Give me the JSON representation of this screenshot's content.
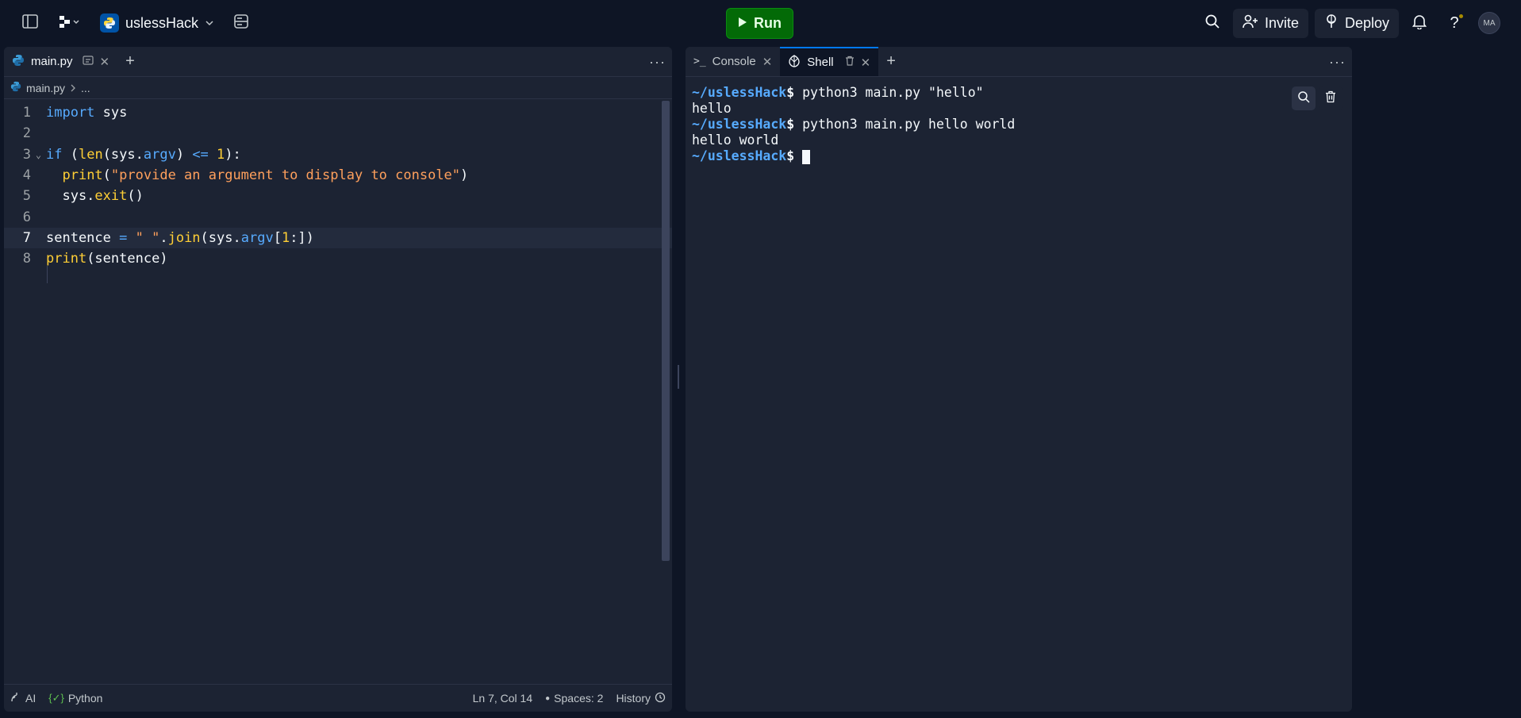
{
  "topbar": {
    "repl_name": "uslessHack",
    "run_label": "Run",
    "invite_label": "Invite",
    "deploy_label": "Deploy",
    "avatar_initials": "MA"
  },
  "editor_tabs": [
    {
      "label": "main.py",
      "active": true
    }
  ],
  "breadcrumb": {
    "file": "main.py",
    "ellipsis": "..."
  },
  "code_lines": [
    {
      "num": "1",
      "text": "import sys"
    },
    {
      "num": "2",
      "text": ""
    },
    {
      "num": "3",
      "text": "if (len(sys.argv) <= 1):"
    },
    {
      "num": "4",
      "text": "  print(\"provide an argument to display to console\")"
    },
    {
      "num": "5",
      "text": "  sys.exit()"
    },
    {
      "num": "6",
      "text": ""
    },
    {
      "num": "7",
      "text": "sentence = \" \".join(sys.argv[1:])"
    },
    {
      "num": "8",
      "text": "print(sentence)"
    }
  ],
  "statusbar": {
    "ai_label": "AI",
    "language": "Python",
    "cursor_position": "Ln 7, Col 14",
    "spaces": "Spaces: 2",
    "history": "History"
  },
  "right_tabs": [
    {
      "label": "Console",
      "active": false
    },
    {
      "label": "Shell",
      "active": true
    }
  ],
  "shell": {
    "prompt": "~/uslessHack",
    "dollar": "$",
    "lines": [
      {
        "type": "cmd",
        "text": " python3 main.py \"hello\""
      },
      {
        "type": "out",
        "text": "hello"
      },
      {
        "type": "cmd",
        "text": " python3 main.py hello world"
      },
      {
        "type": "out",
        "text": "hello world"
      }
    ]
  },
  "colors": {
    "background": "#0e1525",
    "panel": "#1c2333",
    "run_button": "#036a07",
    "keyword": "#57abff",
    "function": "#ffcf35",
    "string": "#ffa05c"
  }
}
